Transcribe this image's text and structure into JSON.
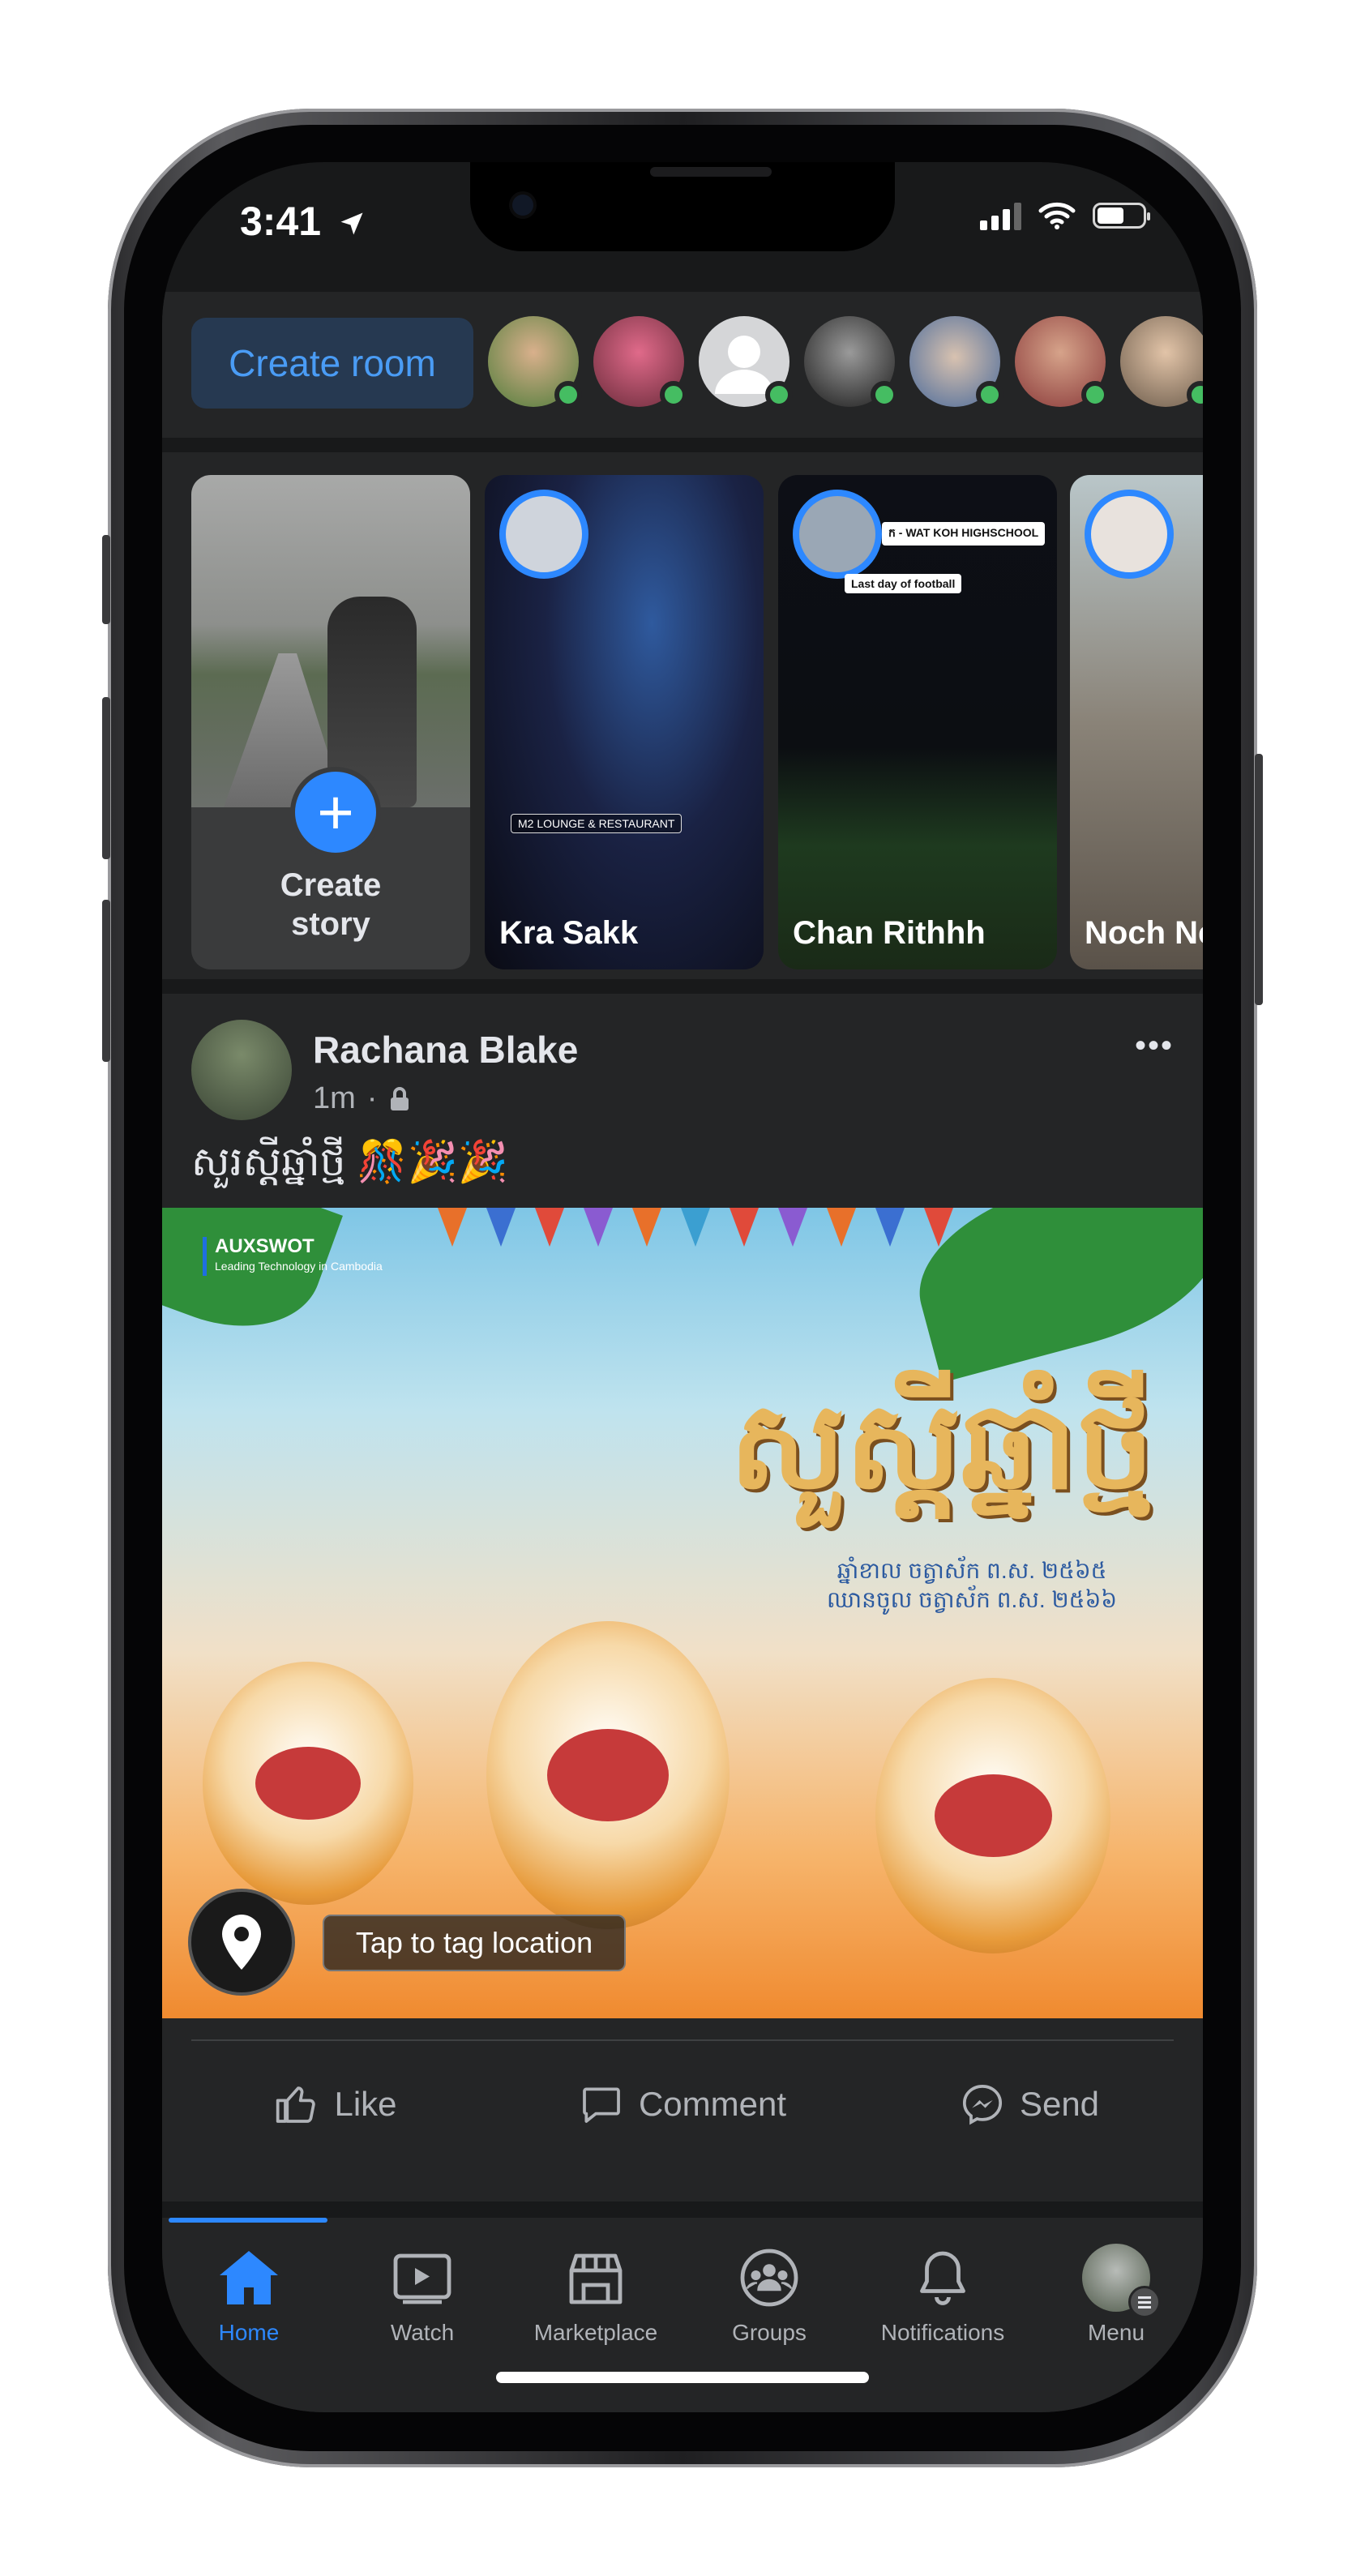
{
  "status_bar": {
    "time": "3:41"
  },
  "rooms": {
    "create_room_label": "Create room"
  },
  "stories": {
    "create_story_label": "Create story",
    "items": [
      {
        "name": "Kra Sakk",
        "tag": "M2 LOUNGE & RESTAURANT"
      },
      {
        "name": "Chan Rithhh",
        "tag_top": "ក - WAT KOH HIGHSCHOOL",
        "tag_bottom": "Last day of football"
      },
      {
        "name": "Noch Ne"
      }
    ]
  },
  "post": {
    "author": "Rachana Blake",
    "time": "1m",
    "separator": "·",
    "more": "•••",
    "text": "សួរស្ដីឆ្នាំថ្មី 🎊🎉🎉",
    "image": {
      "brand": "AUXSWOT",
      "brand_tagline": "Leading Technology in Cambodia",
      "title": "សួស្ដីឆ្នាំថ្មី",
      "subtitle_line1": "ឆ្នាំខាល ចត្វាស័ក ព.ស. ២៥៦៥",
      "subtitle_line2": "ឈានចូល ចត្វាស័ក ព.ស. ២៥៦៦"
    },
    "location_chip": "Tap to tag location",
    "actions": {
      "like": "Like",
      "comment": "Comment",
      "send": "Send"
    }
  },
  "tabs": [
    {
      "label": "Home",
      "active": true
    },
    {
      "label": "Watch"
    },
    {
      "label": "Marketplace"
    },
    {
      "label": "Groups"
    },
    {
      "label": "Notifications"
    },
    {
      "label": "Menu"
    }
  ],
  "colors": {
    "accent": "#2d88ff",
    "online": "#45bd62",
    "surface": "#242526",
    "background": "#18191a"
  }
}
